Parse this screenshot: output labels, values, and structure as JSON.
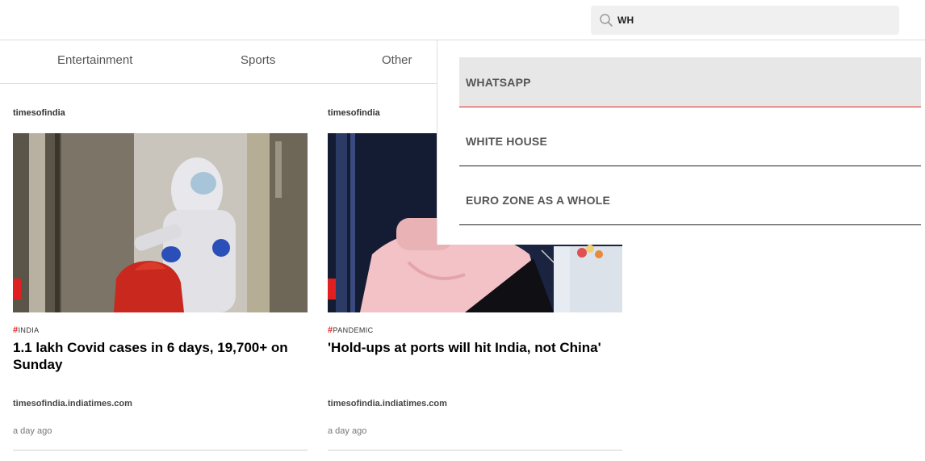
{
  "search": {
    "value": "WH",
    "icon": "search-icon"
  },
  "tabs": [
    {
      "label": "Entertainment"
    },
    {
      "label": "Sports"
    },
    {
      "label": "Other"
    }
  ],
  "cards": [
    {
      "source": "timesofindia",
      "hashtag_symbol": "#",
      "tag": "INDIA",
      "title": "1.1 lakh Covid cases in 6 days, 19,700+ on Sunday",
      "domain": "timesofindia.indiatimes.com",
      "time": "a day ago"
    },
    {
      "source": "timesofindia",
      "hashtag_symbol": "#",
      "tag": "PANDEMIC",
      "title": "'Hold-ups at ports will hit India, not China'",
      "domain": "timesofindia.indiatimes.com",
      "time": "a day ago"
    }
  ],
  "suggestions": [
    {
      "label": "WHATSAPP",
      "highlighted": true
    },
    {
      "label": "WHITE HOUSE",
      "highlighted": false
    },
    {
      "label": "EURO ZONE AS A WHOLE",
      "highlighted": false
    }
  ],
  "colors": {
    "accent": "#e02020",
    "search_bg": "#f0f0f0",
    "highlight_bg": "#e7e7e7"
  }
}
